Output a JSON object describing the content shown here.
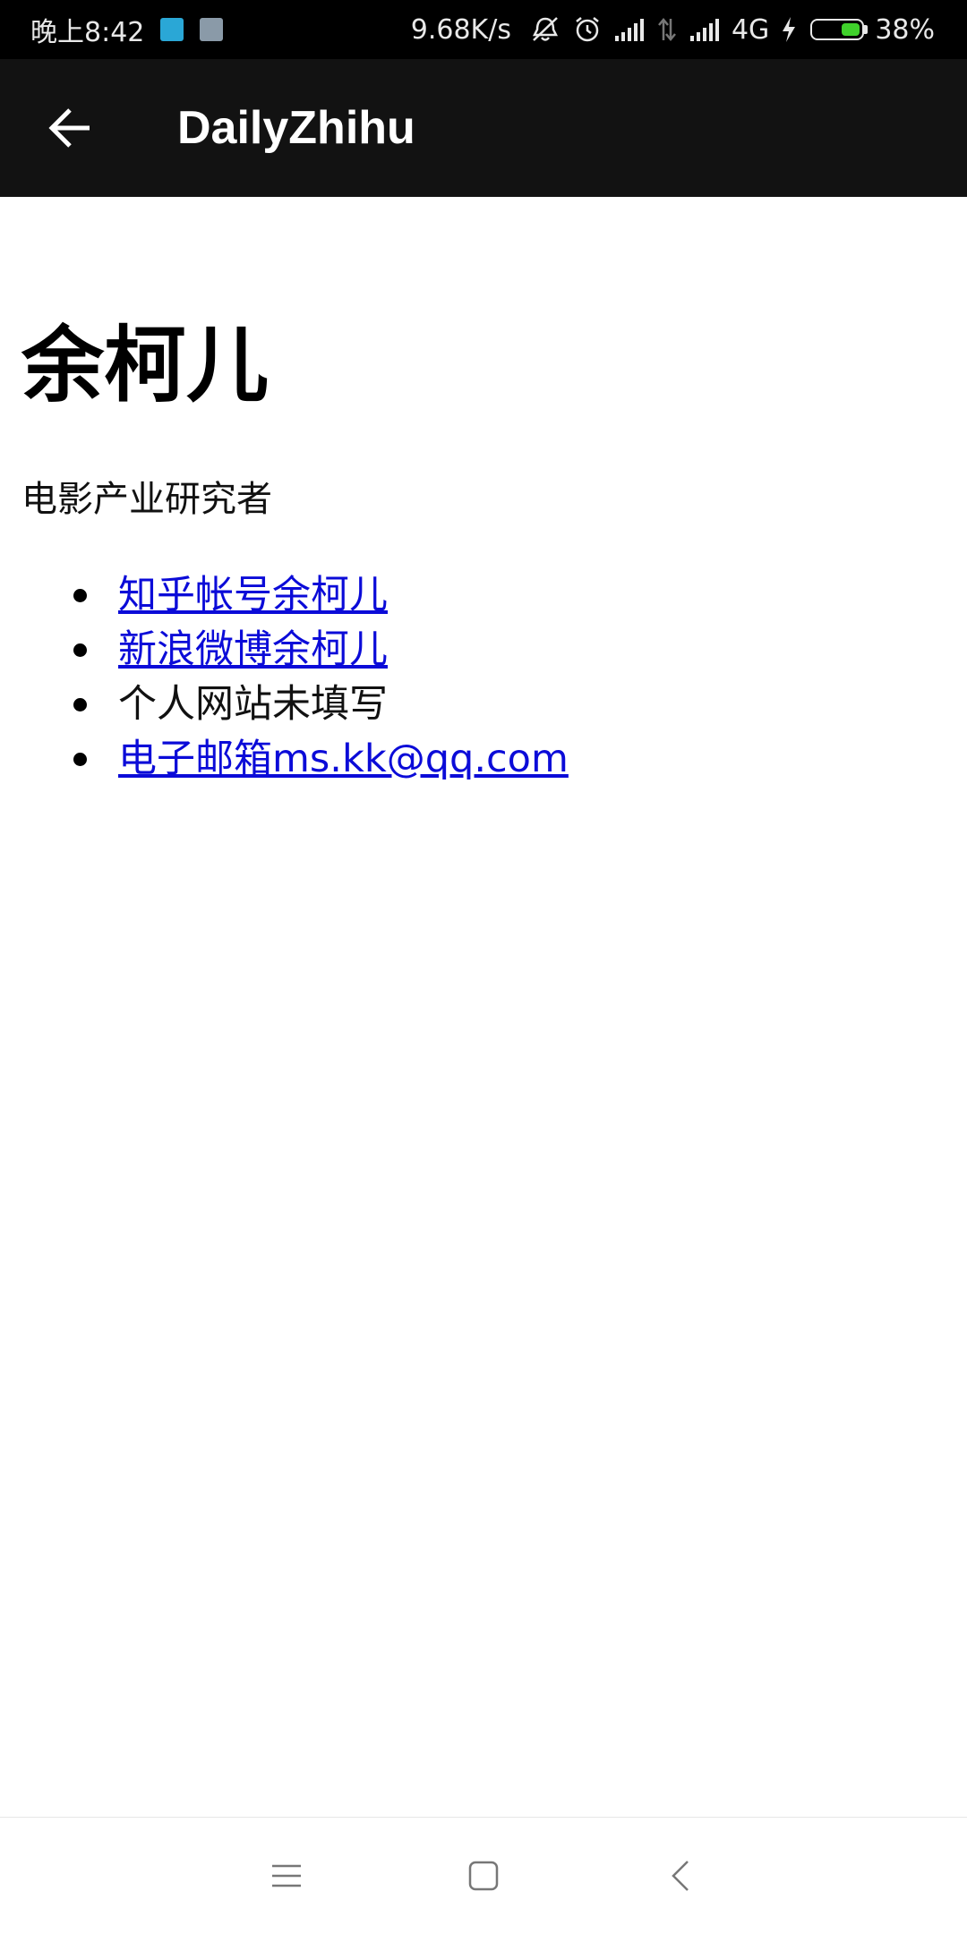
{
  "status_bar": {
    "time": "晚上8:42",
    "net_speed": "9.68K/s",
    "network_type": "4G",
    "battery": "38%",
    "battery_color": "#3fd12b",
    "icons": [
      "calendar-notification-icon",
      "note-notification-icon",
      "mute-icon",
      "alarm-icon",
      "signal-icon",
      "data-arrows-icon",
      "signal-icon",
      "charging-icon",
      "battery-icon"
    ]
  },
  "toolbar": {
    "back_icon": "arrow-left-icon",
    "title": "DailyZhihu"
  },
  "profile": {
    "name": "余柯儿",
    "bio": "电影产业研究者",
    "links": [
      {
        "text": "知乎帐号余柯儿",
        "is_link": true
      },
      {
        "text": "新浪微博余柯儿",
        "is_link": true
      },
      {
        "text": "个人网站未填写",
        "is_link": false
      },
      {
        "text": "电子邮箱ms.kk@qq.com",
        "is_link": true
      }
    ],
    "link_color": "#0b0bd8"
  },
  "nav_bar": {
    "icons": [
      "menu-icon",
      "home-square-icon",
      "back-chevron-icon"
    ]
  }
}
